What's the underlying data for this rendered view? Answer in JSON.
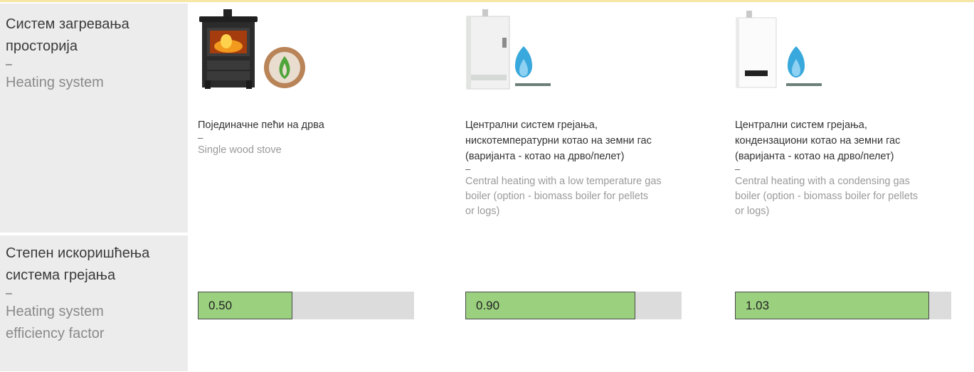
{
  "row_heating": {
    "label_sr_line1": "Систем загревања",
    "label_sr_line2": "просторија",
    "dash": "–",
    "label_en": "Heating system"
  },
  "row_efficiency": {
    "label_sr_line1": "Степен искоришћења",
    "label_sr_line2": "система грејања",
    "dash": "–",
    "label_en_line1": "Heating system",
    "label_en_line2": "efficiency factor"
  },
  "systems": [
    {
      "icon": "wood-stove-with-biomass-leaf-icon",
      "sr_lines": [
        "Појединачне пећи на дрва"
      ],
      "dash": "–",
      "en_lines": [
        "Single wood stove"
      ],
      "efficiency": "0.50",
      "efficiency_value": 0.5,
      "fill_color": "#9bd07f",
      "track_color": "#dcdcdc"
    },
    {
      "icon": "gas-boiler-with-flame-icon",
      "sr_lines": [
        "Централни систем грејања,",
        "нискотемпературни котао на земни гас",
        "(варијанта - котао на дрво/пелет)"
      ],
      "dash": "–",
      "en_lines": [
        "Central heating with a low temperature gas",
        "boiler (option  - biomass boiler for pellets",
        "or logs)"
      ],
      "efficiency": "0.90",
      "efficiency_value": 0.9,
      "fill_color": "#9bd07f",
      "track_color": "#dcdcdc"
    },
    {
      "icon": "condensing-boiler-with-flame-icon",
      "sr_lines": [
        "Централни систем грејања,",
        "кондензациони котао на земни гас",
        "(варијанта - котао на дрво/пелет)"
      ],
      "dash": "–",
      "en_lines": [
        "Central heating with a condensing gas",
        "boiler (option  - biomass boiler for pellets",
        "or logs)"
      ],
      "efficiency": "1.03",
      "efficiency_value": 1.03,
      "fill_color": "#9bd07f",
      "track_color": "#dcdcdc"
    }
  ]
}
